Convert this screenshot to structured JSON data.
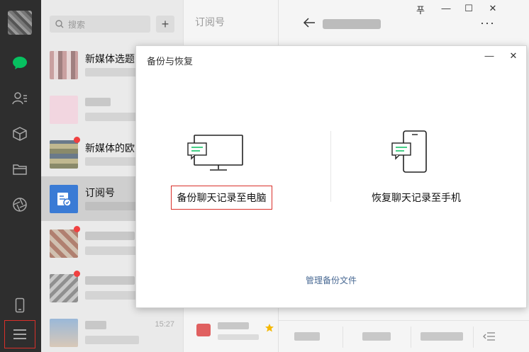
{
  "search": {
    "placeholder": "搜索",
    "add_symbol": "+"
  },
  "conversations": [
    {
      "title": "新媒体选题",
      "unread": false
    },
    {
      "title": "",
      "unread": false
    },
    {
      "title": "新媒体的欧",
      "unread": true
    },
    {
      "title": "订阅号",
      "unread": false
    },
    {
      "title": "",
      "unread": true
    },
    {
      "title": "",
      "unread": true
    },
    {
      "title": "",
      "unread": false,
      "time": "15:27"
    }
  ],
  "middle": {
    "title": "订阅号"
  },
  "right": {
    "more_label": "···"
  },
  "window_controls": {
    "pin": "푸",
    "minimize": "—",
    "maximize": "☐",
    "close": "✕"
  },
  "dialog": {
    "title": "备份与恢复",
    "minimize": "—",
    "close": "✕",
    "backup_label": "备份聊天记录至电脑",
    "restore_label": "恢复聊天记录至手机",
    "manage_label": "管理备份文件"
  },
  "colors": {
    "accent": "#07c160",
    "highlight_border": "#d9302a",
    "link": "#4a6a94",
    "rail": "#2e2e2e"
  }
}
